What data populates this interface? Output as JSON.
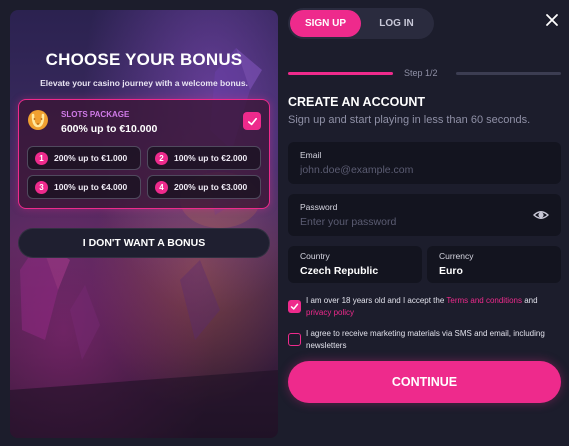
{
  "bonus": {
    "title": "CHOOSE YOUR BONUS",
    "subtitle": "Elevate your casino journey with a welcome bonus.",
    "package": {
      "name": "SLOTS PACKAGE",
      "amount": "600% up to €10.000",
      "selected": true
    },
    "options": [
      {
        "num": "1",
        "text": "200% up to €1.000"
      },
      {
        "num": "2",
        "text": "100% up to €2.000"
      },
      {
        "num": "3",
        "text": "100% up to €4.000"
      },
      {
        "num": "4",
        "text": "200% up to €3.000"
      }
    ],
    "no_bonus_label": "I DON'T WANT A BONUS"
  },
  "tabs": {
    "signup": "SIGN UP",
    "login": "LOG IN",
    "active": "signup"
  },
  "step": {
    "label": "Step 1/2",
    "current": 1,
    "total": 2
  },
  "form": {
    "title": "CREATE AN ACCOUNT",
    "subtitle": "Sign up and start playing in less than 60 seconds.",
    "email": {
      "label": "Email",
      "placeholder": "john.doe@example.com",
      "value": ""
    },
    "password": {
      "label": "Password",
      "placeholder": "Enter your password",
      "value": ""
    },
    "country": {
      "label": "Country",
      "value": "Czech Republic"
    },
    "currency": {
      "label": "Currency",
      "value": "Euro"
    },
    "consent_age": {
      "checked": true,
      "text_before": "I am over 18 years old and I accept the ",
      "link1": "Terms and conditions",
      "text_middle": " and ",
      "link2": "privacy policy"
    },
    "consent_marketing": {
      "checked": false,
      "text": "I agree to receive marketing materials via SMS and email, including newsletters"
    },
    "continue_label": "CONTINUE"
  },
  "colors": {
    "accent": "#ee2a8c",
    "background": "#1c1d2c",
    "field_bg": "#13141f",
    "muted_text": "#8f90a6"
  },
  "icons": {
    "close": "close-icon",
    "eye": "eye-icon",
    "check": "check-icon",
    "package": "horseshoe-icon"
  }
}
